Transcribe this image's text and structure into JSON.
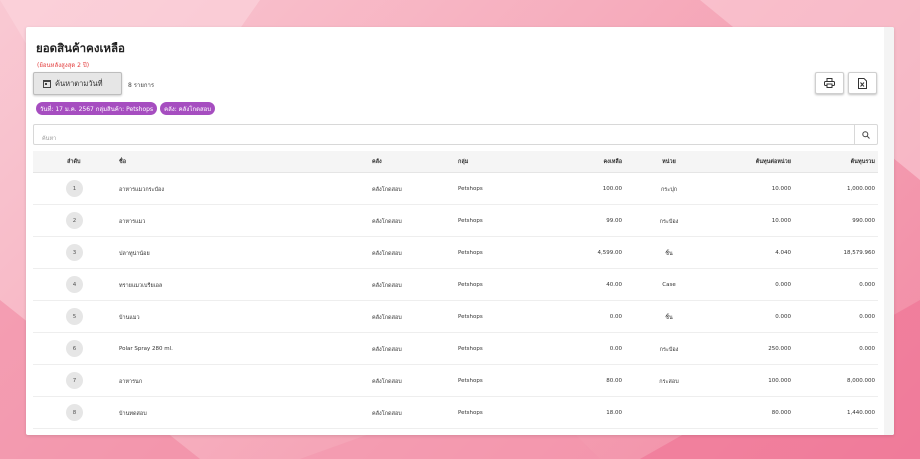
{
  "page": {
    "title": "ยอดสินค้าคงเหลือ",
    "subtitle": "(ย้อนหลังสูงสุด 2 ปี)",
    "search_date_label": "ค้นหาตามวันที่",
    "record_count": "8 รายการ"
  },
  "filters": [
    "วันที่: 17 ม.ค. 2567 กลุ่มสินค้า: Petshops",
    "คลัง: คลังโกดสอบ"
  ],
  "search": {
    "placeholder": "ค้นหา",
    "value": ""
  },
  "table": {
    "columns": {
      "index": "ลำดับ",
      "name": "ชื่อ",
      "warehouse": "คลัง",
      "group": "กลุ่ม",
      "quantity": "คงเหลือ",
      "unit": "หน่วย",
      "unit_cost": "ต้นทุนต่อหน่วย",
      "total_cost": "ต้นทุนรวม"
    },
    "rows": [
      {
        "index": "1",
        "name": "อาหารแมวกระป๋อง",
        "warehouse": "คลังโกดสอบ",
        "group": "Petshops",
        "quantity": "100.00",
        "unit": "กระปุก",
        "unit_cost": "10.000",
        "total_cost": "1,000.000"
      },
      {
        "index": "2",
        "name": "อาหารแมว",
        "warehouse": "คลังโกดสอบ",
        "group": "Petshops",
        "quantity": "99.00",
        "unit": "กระป๋อง",
        "unit_cost": "10.000",
        "total_cost": "990.000"
      },
      {
        "index": "3",
        "name": "ปลาทูน่าน้อย",
        "warehouse": "คลังโกดสอบ",
        "group": "Petshops",
        "quantity": "4,599.00",
        "unit": "ชิ้น",
        "unit_cost": "4.040",
        "total_cost": "18,579.960"
      },
      {
        "index": "4",
        "name": "ทรายแมวเบรียเอล",
        "warehouse": "คลังโกดสอบ",
        "group": "Petshops",
        "quantity": "40.00",
        "unit": "Case",
        "unit_cost": "0.000",
        "total_cost": "0.000"
      },
      {
        "index": "5",
        "name": "บ้านแมว",
        "warehouse": "คลังโกดสอบ",
        "group": "Petshops",
        "quantity": "0.00",
        "unit": "ชิ้น",
        "unit_cost": "0.000",
        "total_cost": "0.000"
      },
      {
        "index": "6",
        "name": "Polar Spray 280 ml.",
        "warehouse": "คลังโกดสอบ",
        "group": "Petshops",
        "quantity": "0.00",
        "unit": "กระป๋อง",
        "unit_cost": "250.000",
        "total_cost": "0.000"
      },
      {
        "index": "7",
        "name": "อาหารนก",
        "warehouse": "คลังโกดสอบ",
        "group": "Petshops",
        "quantity": "80.00",
        "unit": "กระสอบ",
        "unit_cost": "100.000",
        "total_cost": "8,000.000"
      },
      {
        "index": "8",
        "name": "บ้านทดสอบ",
        "warehouse": "คลังโกดสอบ",
        "group": "Petshops",
        "quantity": "18.00",
        "unit": "",
        "unit_cost": "80.000",
        "total_cost": "1,440.000"
      }
    ]
  },
  "icons": {
    "calendar": "calendar-icon",
    "print": "print-icon",
    "excel": "excel-icon",
    "search": "search-icon"
  },
  "colors": {
    "chip": "#a64ec0",
    "subtitle": "#e23b3b"
  }
}
